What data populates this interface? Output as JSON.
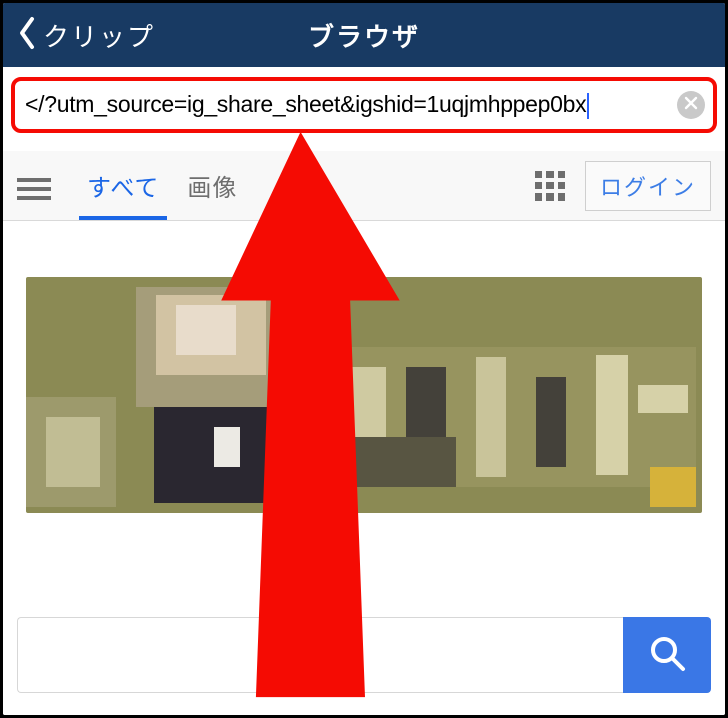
{
  "appbar": {
    "back_label": "クリップ",
    "title": "ブラウザ"
  },
  "url_bar": {
    "value": "</?utm_source=ig_share_sheet&igshid=1uqjmhppep0bx"
  },
  "toolbar": {
    "tab_all": "すべて",
    "tab_images": "画像",
    "login_label": "ログイン"
  },
  "search": {
    "placeholder": ""
  }
}
